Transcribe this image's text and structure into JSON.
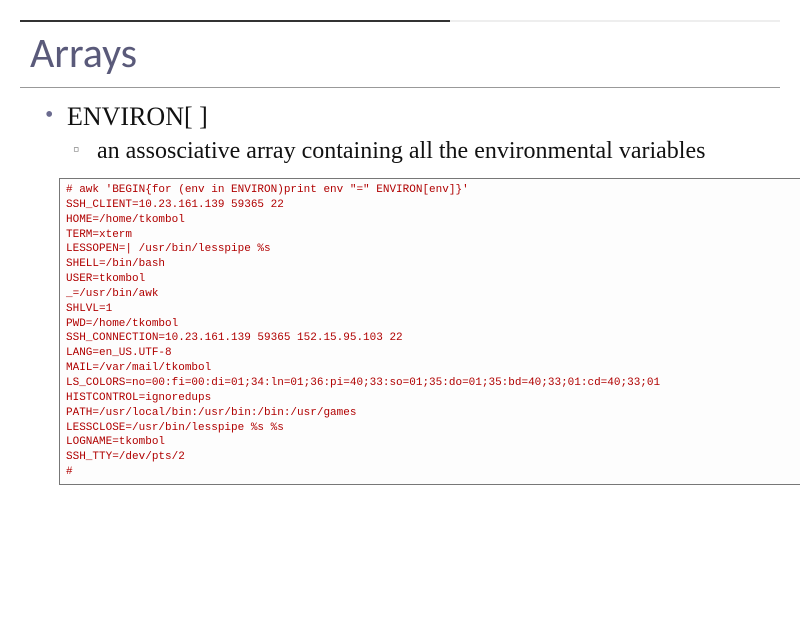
{
  "title": "Arrays",
  "bullet1": "ENVIRON[ ]",
  "bullet2": "an assosciative array containing all the environmental variables",
  "code_lines": [
    "# awk 'BEGIN{for (env in ENVIRON)print env \"=\" ENVIRON[env]}'",
    "SSH_CLIENT=10.23.161.139 59365 22",
    "HOME=/home/tkombol",
    "TERM=xterm",
    "LESSOPEN=| /usr/bin/lesspipe %s",
    "SHELL=/bin/bash",
    "USER=tkombol",
    "_=/usr/bin/awk",
    "SHLVL=1",
    "PWD=/home/tkombol",
    "SSH_CONNECTION=10.23.161.139 59365 152.15.95.103 22",
    "LANG=en_US.UTF-8",
    "MAIL=/var/mail/tkombol",
    "LS_COLORS=no=00:fi=00:di=01;34:ln=01;36:pi=40;33:so=01;35:do=01;35:bd=40;33;01:cd=40;33;01",
    "HISTCONTROL=ignoredups",
    "PATH=/usr/local/bin:/usr/bin:/bin:/usr/games",
    "LESSCLOSE=/usr/bin/lesspipe %s %s",
    "LOGNAME=tkombol",
    "SSH_TTY=/dev/pts/2",
    "#"
  ]
}
